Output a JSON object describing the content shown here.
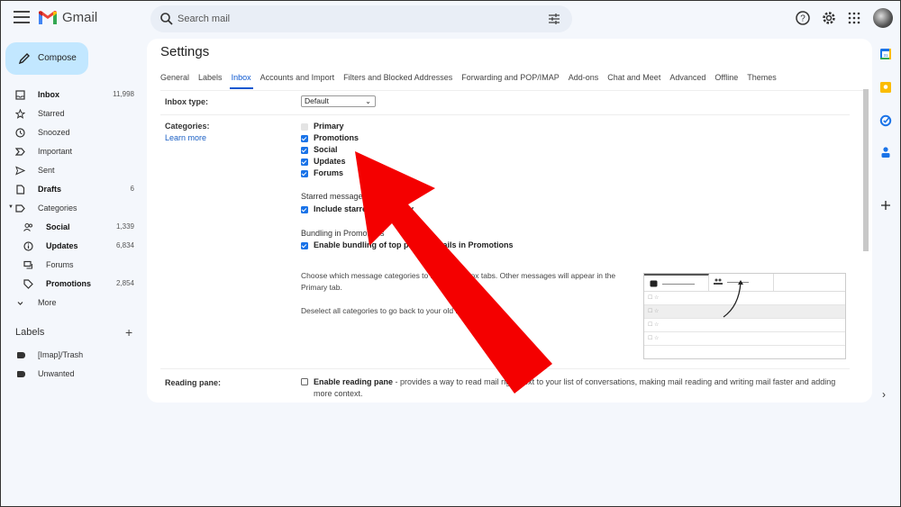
{
  "app": {
    "brand": "Gmail"
  },
  "search": {
    "placeholder": "Search mail"
  },
  "header_icons": [
    "help-icon",
    "settings-icon",
    "apps-icon",
    "avatar"
  ],
  "compose": {
    "label": "Compose"
  },
  "sidebar": {
    "items": [
      {
        "label": "Inbox",
        "count": "11,998",
        "icon": "inbox-icon",
        "bold": true
      },
      {
        "label": "Starred",
        "count": "",
        "icon": "star-icon"
      },
      {
        "label": "Snoozed",
        "count": "",
        "icon": "clock-icon"
      },
      {
        "label": "Important",
        "count": "",
        "icon": "important-icon"
      },
      {
        "label": "Sent",
        "count": "",
        "icon": "send-icon"
      },
      {
        "label": "Drafts",
        "count": "6",
        "icon": "draft-icon",
        "bold": true
      },
      {
        "label": "Categories",
        "count": "",
        "icon": "label-icon"
      },
      {
        "label": "Social",
        "count": "1,339",
        "icon": "people-icon",
        "bold": true
      },
      {
        "label": "Updates",
        "count": "6,834",
        "icon": "info-icon",
        "bold": true
      },
      {
        "label": "Forums",
        "count": "",
        "icon": "forum-icon"
      },
      {
        "label": "Promotions",
        "count": "2,854",
        "icon": "tag-icon",
        "bold": true
      },
      {
        "label": "More",
        "count": "",
        "icon": "chevron-down-icon"
      }
    ],
    "labels_heading": "Labels",
    "labels_add": "+",
    "labels": [
      {
        "label": "[Imap]/Trash"
      },
      {
        "label": "Unwanted"
      }
    ]
  },
  "settings": {
    "title": "Settings",
    "tabs": [
      {
        "label": "General"
      },
      {
        "label": "Labels"
      },
      {
        "label": "Inbox",
        "active": true
      },
      {
        "label": "Accounts and Import"
      },
      {
        "label": "Filters and Blocked Addresses"
      },
      {
        "label": "Forwarding and POP/IMAP"
      },
      {
        "label": "Add-ons"
      },
      {
        "label": "Chat and Meet"
      },
      {
        "label": "Advanced"
      },
      {
        "label": "Offline"
      },
      {
        "label": "Themes"
      }
    ],
    "inbox_type": {
      "label": "Inbox type:",
      "value": "Default"
    },
    "categories": {
      "label": "Categories:",
      "learn_more": "Learn more",
      "options": [
        {
          "label": "Primary",
          "checked": true,
          "disabled": true
        },
        {
          "label": "Promotions",
          "checked": true
        },
        {
          "label": "Social",
          "checked": true
        },
        {
          "label": "Updates",
          "checked": true
        },
        {
          "label": "Forums",
          "checked": true
        }
      ],
      "starred_heading": "Starred messages",
      "starred_option": "Include starred in Primary",
      "bundling_heading": "Bundling in Promotions",
      "bundling_option": "Enable bundling of top promo emails in Promotions",
      "para1": "Choose which message categories to show as inbox tabs. Other messages will appear in the Primary tab.",
      "para2": "Deselect all categories to go back to your old inbox."
    },
    "reading_pane": {
      "label": "Reading pane:",
      "option_bold": "Enable reading pane",
      "option_rest": " - provides a way to read mail right next to your list of conversations, making mail reading and writing mail faster and adding more context.",
      "checked": false
    }
  },
  "annotation": {
    "type": "arrow",
    "color": "#f40000",
    "points_to": "Promotions / Social categories"
  },
  "side_panel": {
    "icons": [
      "calendar-icon",
      "keep-icon",
      "tasks-icon",
      "contacts-icon",
      "add-icon"
    ],
    "expand": "›"
  }
}
